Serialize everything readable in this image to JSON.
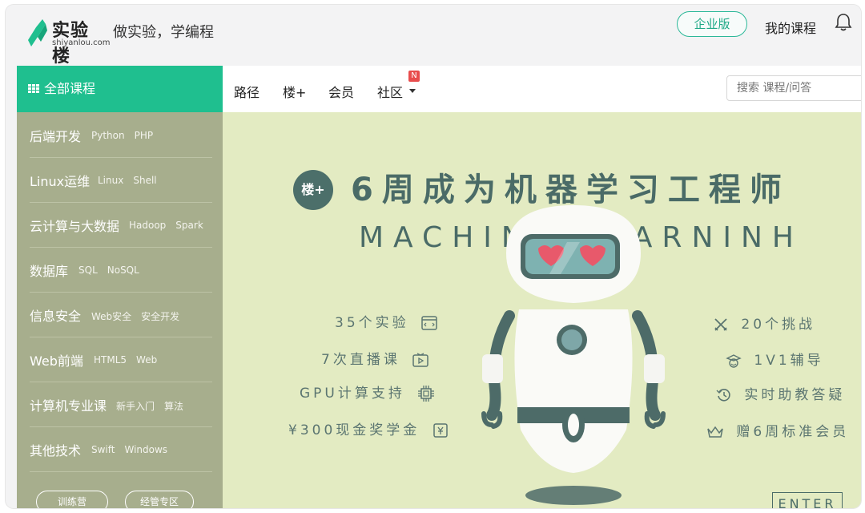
{
  "header": {
    "logo_name": "实验楼",
    "logo_domain": "shiyanlou.com",
    "slogan": "做实验，学编程",
    "enterprise_label": "企业版",
    "my_courses_label": "我的课程",
    "brand_color": "#1fbf8f"
  },
  "sidebar": {
    "title": "全部课程",
    "items": [
      {
        "label": "后端开发",
        "subs": [
          "Python",
          "PHP"
        ]
      },
      {
        "label": "Linux运维",
        "subs": [
          "Linux",
          "Shell"
        ]
      },
      {
        "label": "云计算与大数据",
        "subs": [
          "Hadoop",
          "Spark"
        ]
      },
      {
        "label": "数据库",
        "subs": [
          "SQL",
          "NoSQL"
        ]
      },
      {
        "label": "信息安全",
        "subs": [
          "Web安全",
          "安全开发"
        ]
      },
      {
        "label": "Web前端",
        "subs": [
          "HTML5",
          "Web"
        ]
      },
      {
        "label": "计算机专业课",
        "subs": [
          "新手入门",
          "算法"
        ]
      },
      {
        "label": "其他技术",
        "subs": [
          "Swift",
          "Windows"
        ]
      }
    ],
    "buttons": [
      "训练营",
      "经管专区"
    ]
  },
  "nav": {
    "items": [
      "路径",
      "楼+",
      "会员",
      "社区"
    ],
    "community_badge": "N",
    "search_placeholder": "搜索 课程/问答"
  },
  "banner": {
    "badge": "楼+",
    "headline": "6周成为机器学习工程师",
    "subline": "MACHINE LEARNINH",
    "features_left": [
      "35个实验",
      "7次直播课",
      "GPU计算支持",
      "¥300现金奖学金"
    ],
    "features_right": [
      "20个挑战",
      "1V1辅导",
      "实时助教答疑",
      "赠6周标准会员"
    ],
    "enter_label": "ENTER",
    "bg_color": "#e3ebc2",
    "text_color": "#4a6b67"
  }
}
